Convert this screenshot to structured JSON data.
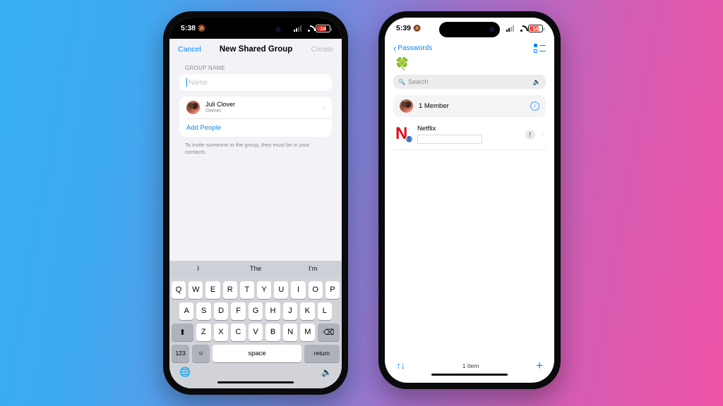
{
  "background": {
    "color_left": "#39b0f4",
    "color_mid": "#7c87d8",
    "color_right": "#ee52a6"
  },
  "accent": {
    "blue": "#0a84ff",
    "red": "#e50914",
    "grey": "#8a8a8e"
  },
  "left_phone": {
    "status_bar": {
      "time": "5:38",
      "bell_icon": "bell-slash-icon",
      "cellular_icon": "cellular-bars-icon",
      "wifi_icon": "wifi-icon",
      "battery_level": "14"
    },
    "nav": {
      "cancel": "Cancel",
      "title": "New Shared Group",
      "create": "Create"
    },
    "form": {
      "section_label": "GROUP NAME",
      "name_placeholder": "Name",
      "name_value": ""
    },
    "member": {
      "name": "Juli Clover",
      "role": "Owner",
      "chevron": "›"
    },
    "add_people": "Add People",
    "footnote": "To invite someone to the group, they must be in your contacts.",
    "keyboard": {
      "predictions": [
        "I",
        "The",
        "I’m"
      ],
      "row1": [
        "Q",
        "W",
        "E",
        "R",
        "T",
        "Y",
        "U",
        "I",
        "O",
        "P"
      ],
      "row2": [
        "A",
        "S",
        "D",
        "F",
        "G",
        "H",
        "J",
        "K",
        "L"
      ],
      "row3": [
        "Z",
        "X",
        "C",
        "V",
        "B",
        "N",
        "M"
      ],
      "shift": "⬆",
      "backspace": "⌫",
      "numbers": "123",
      "emoji": "☺",
      "space": "space",
      "return": "return",
      "globe": "⊕",
      "mic": "🎙"
    }
  },
  "right_phone": {
    "status_bar": {
      "time": "5:39",
      "bell_icon": "bell-slash-icon",
      "cellular_icon": "cellular-bars-icon",
      "wifi_icon": "wifi-icon",
      "battery_level": "14"
    },
    "nav": {
      "back_label": "Passwords",
      "back_chevron": "‹",
      "options_icon": "list-view-options-icon"
    },
    "group_emoji": "🍀",
    "search": {
      "placeholder": "Search",
      "value": "",
      "search_icon": "search-icon",
      "mic_icon": "microphone-icon"
    },
    "member_row": {
      "label": "1 Member",
      "info_icon": "info-circle-icon",
      "info_glyph": "i"
    },
    "items": [
      {
        "title": "Netflix",
        "logo": "N",
        "logo_badge": "shared-group-icon",
        "username_redacted": true,
        "warning_glyph": "!",
        "chevron": "›"
      }
    ],
    "toolbar": {
      "sort_icon": "↑↓",
      "count": "1 Item",
      "add": "+"
    }
  }
}
